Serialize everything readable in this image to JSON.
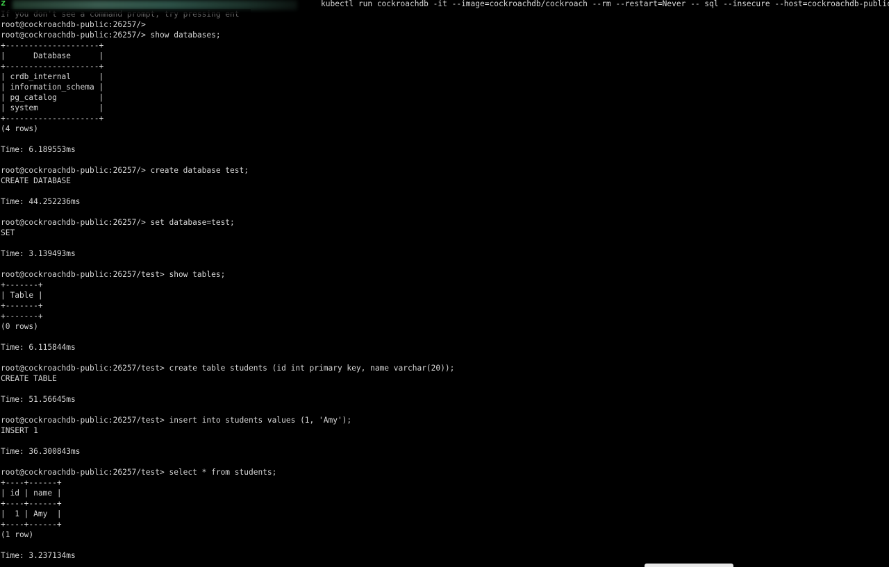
{
  "window": {
    "tab_indicator": "z",
    "header_command": "kubectl run cockroachdb -it --image=cockroachdb/cockroach --rm --restart=Never -- sql --insecure --host=cockroachdb-public"
  },
  "terminal": {
    "lines": [
      "If you don't see a command prompt, try pressing ent",
      "root@cockroachdb-public:26257/>",
      "root@cockroachdb-public:26257/> show databases;",
      "+--------------------+",
      "|      Database      |",
      "+--------------------+",
      "| crdb_internal      |",
      "| information_schema |",
      "| pg_catalog         |",
      "| system             |",
      "+--------------------+",
      "(4 rows)",
      "",
      "Time: 6.189553ms",
      "",
      "root@cockroachdb-public:26257/> create database test;",
      "CREATE DATABASE",
      "",
      "Time: 44.252236ms",
      "",
      "root@cockroachdb-public:26257/> set database=test;",
      "SET",
      "",
      "Time: 3.139493ms",
      "",
      "root@cockroachdb-public:26257/test> show tables;",
      "+-------+",
      "| Table |",
      "+-------+",
      "+-------+",
      "(0 rows)",
      "",
      "Time: 6.115844ms",
      "",
      "root@cockroachdb-public:26257/test> create table students (id int primary key, name varchar(20));",
      "CREATE TABLE",
      "",
      "Time: 51.56645ms",
      "",
      "root@cockroachdb-public:26257/test> insert into students values (1, 'Amy');",
      "INSERT 1",
      "",
      "Time: 36.300843ms",
      "",
      "root@cockroachdb-public:26257/test> select * from students;",
      "+----+------+",
      "| id | name |",
      "+----+------+",
      "|  1 | Amy  |",
      "+----+------+",
      "(1 row)",
      "",
      "Time: 3.237134ms"
    ]
  },
  "colors": {
    "background": "#000000",
    "foreground": "#d8d8d8",
    "tab_indicator": "#3fd24a"
  }
}
